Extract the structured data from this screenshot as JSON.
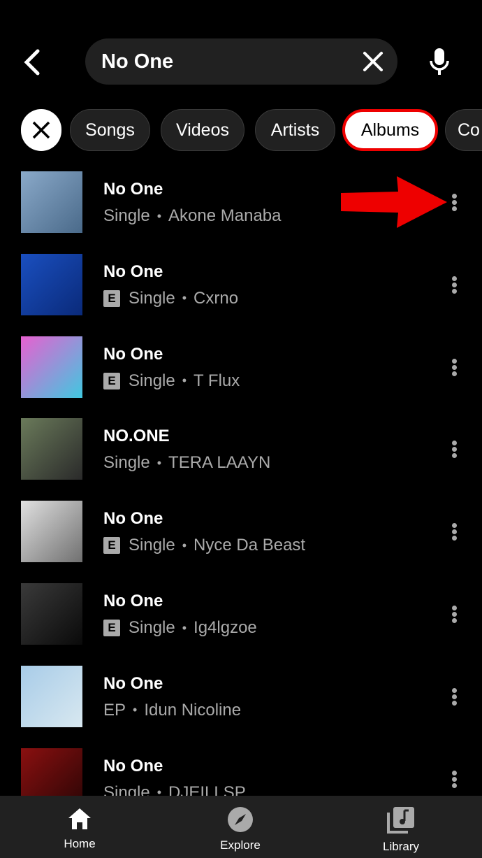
{
  "search": {
    "query": "No One"
  },
  "chips": [
    {
      "label": "Songs"
    },
    {
      "label": "Videos"
    },
    {
      "label": "Artists"
    },
    {
      "label": "Albums",
      "selected": true
    },
    {
      "label": "Co"
    }
  ],
  "results": [
    {
      "title": "No One",
      "type": "Single",
      "artist": "Akone Manaba",
      "explicit": false,
      "art": [
        "#8aa9c9",
        "#4a6a8a"
      ]
    },
    {
      "title": "No One",
      "type": "Single",
      "artist": "Cxrno",
      "explicit": true,
      "art": [
        "#1a4fbf",
        "#0a2a7a"
      ]
    },
    {
      "title": "No One",
      "type": "Single",
      "artist": "T Flux",
      "explicit": true,
      "art": [
        "#e860d0",
        "#40c8e0"
      ]
    },
    {
      "title": "NO.ONE",
      "type": "Single",
      "artist": "TERA LAAYN",
      "explicit": false,
      "art": [
        "#6a7a5a",
        "#2a2a2a"
      ]
    },
    {
      "title": "No One",
      "type": "Single",
      "artist": "Nyce Da Beast",
      "explicit": true,
      "art": [
        "#e0e0e0",
        "#707070"
      ]
    },
    {
      "title": "No One",
      "type": "Single",
      "artist": "Ig4lgzoe",
      "explicit": true,
      "art": [
        "#3a3a3a",
        "#0a0a0a"
      ]
    },
    {
      "title": "No One",
      "type": "EP",
      "artist": "Idun Nicoline",
      "explicit": false,
      "art": [
        "#a8cce8",
        "#d8e8f0"
      ]
    },
    {
      "title": "No One",
      "type": "Single",
      "artist": "DJEILLSP",
      "explicit": false,
      "art": [
        "#8a1010",
        "#2a0505"
      ]
    }
  ],
  "separator": "•",
  "explicit_label": "E",
  "nav": [
    {
      "label": "Home",
      "active": true
    },
    {
      "label": "Explore"
    },
    {
      "label": "Library"
    }
  ],
  "colors": {
    "accent": "#ee0000",
    "surface": "#212121"
  }
}
